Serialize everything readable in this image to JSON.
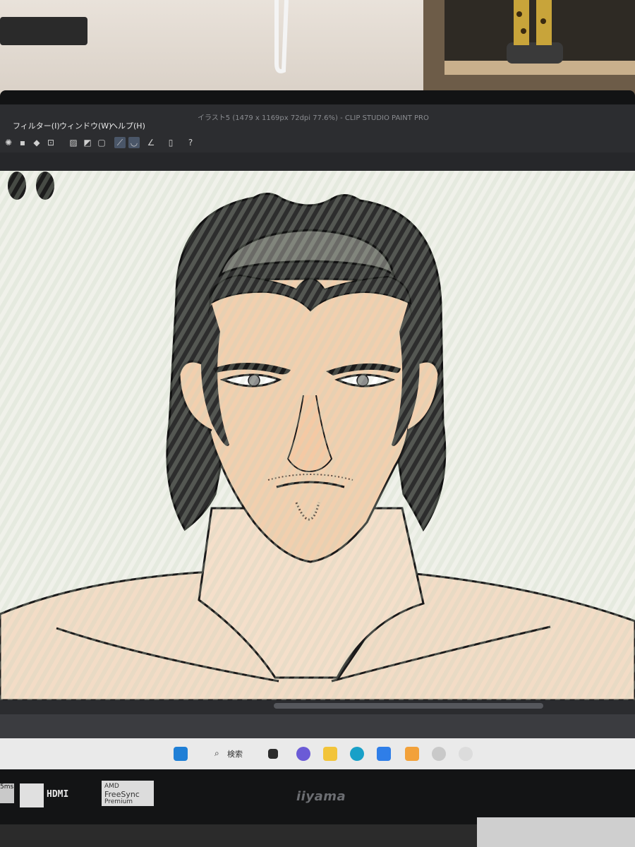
{
  "window": {
    "title": "イラスト5 (1479 x 1169px 72dpi 77.6%) - CLIP STUDIO PAINT PRO"
  },
  "menubar": {
    "items": [
      "フィルター(I)",
      "ウィンドウ(W)",
      "ヘルプ(H)"
    ]
  },
  "toolbar": {
    "icons": [
      "loading-icon",
      "layer-icon",
      "fill-icon",
      "transform-icon",
      "ruler-icon",
      "pen-icon",
      "brush-icon",
      "corner-icon",
      "phone-icon",
      "help-icon"
    ]
  },
  "taskbar": {
    "search_label": "検索",
    "icons": [
      "windows-start-icon",
      "search-icon",
      "task-view-icon",
      "chat-icon",
      "file-explorer-icon",
      "edge-icon",
      "store-icon",
      "app-icon",
      "clip-studio-icon",
      "clip-studio-paint-icon"
    ]
  },
  "bezel": {
    "hdmi_label": "HDMI",
    "freesync_label": "FreeSync",
    "freesync_sub": "Premium",
    "freesync_brand": "AMD",
    "brand_label": "iiyama",
    "corner_label": "5ms"
  },
  "colors": {
    "canvas_bg": "#f0f1ea",
    "skin": "#f2cfae",
    "hair": "#2d2d2d",
    "headband": "#6a6a66",
    "app_dark": "#2c2d30",
    "taskbar": "#eaeaea"
  }
}
